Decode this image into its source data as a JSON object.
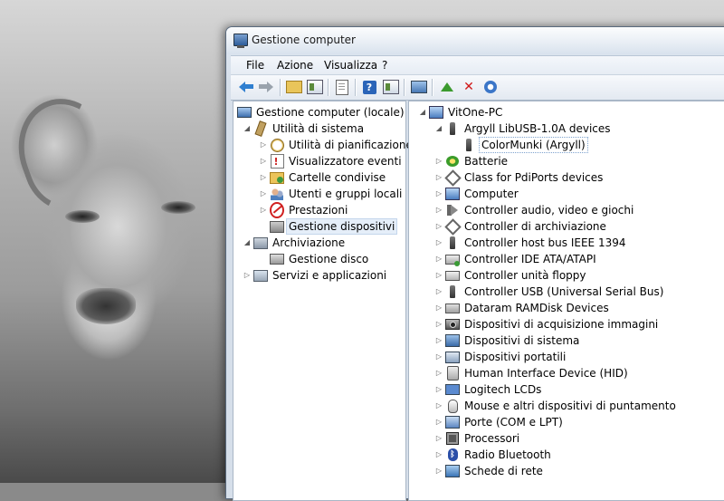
{
  "window": {
    "title": "Gestione computer"
  },
  "menu": [
    "File",
    "Azione",
    "Visualizza",
    "?"
  ],
  "toolbar": [
    {
      "icon": "back-arrow-icon"
    },
    {
      "icon": "forward-arrow-icon"
    },
    {
      "icon": "up-folder-icon"
    },
    {
      "icon": "show-hide-console-tree-icon"
    },
    {
      "icon": "export-list-icon"
    },
    {
      "icon": "help-icon"
    },
    {
      "icon": "show-action-pane-icon"
    },
    {
      "icon": "scan-hardware-icon"
    },
    {
      "icon": "update-driver-icon"
    },
    {
      "icon": "uninstall-icon"
    },
    {
      "icon": "disable-device-icon"
    }
  ],
  "left_tree": {
    "root": "Gestione computer (locale)",
    "items": [
      {
        "label": "Utilità di sistema"
      },
      {
        "label": "Utilità di pianificazione"
      },
      {
        "label": "Visualizzatore eventi"
      },
      {
        "label": "Cartelle condivise"
      },
      {
        "label": "Utenti e gruppi locali"
      },
      {
        "label": "Prestazioni"
      },
      {
        "label": "Gestione dispositivi"
      },
      {
        "label": "Archiviazione"
      },
      {
        "label": "Gestione disco"
      },
      {
        "label": "Servizi e applicazioni"
      }
    ]
  },
  "device_tree": {
    "root": "VitOne-PC",
    "items": [
      {
        "label": "Argyll LibUSB-1.0A devices"
      },
      {
        "label": "ColorMunki (Argyll)"
      },
      {
        "label": "Batterie"
      },
      {
        "label": "Class for PdiPorts devices"
      },
      {
        "label": "Computer"
      },
      {
        "label": "Controller audio, video e giochi"
      },
      {
        "label": "Controller di archiviazione"
      },
      {
        "label": "Controller host bus IEEE 1394"
      },
      {
        "label": "Controller IDE ATA/ATAPI"
      },
      {
        "label": "Controller unità floppy"
      },
      {
        "label": "Controller USB (Universal Serial Bus)"
      },
      {
        "label": "Dataram RAMDisk Devices"
      },
      {
        "label": "Dispositivi di acquisizione immagini"
      },
      {
        "label": "Dispositivi di sistema"
      },
      {
        "label": "Dispositivi portatili"
      },
      {
        "label": "Human Interface Device (HID)"
      },
      {
        "label": "Logitech LCDs"
      },
      {
        "label": "Mouse e altri dispositivi di puntamento"
      },
      {
        "label": "Porte (COM e LPT)"
      },
      {
        "label": "Processori"
      },
      {
        "label": "Radio Bluetooth"
      },
      {
        "label": "Schede di rete"
      }
    ]
  }
}
